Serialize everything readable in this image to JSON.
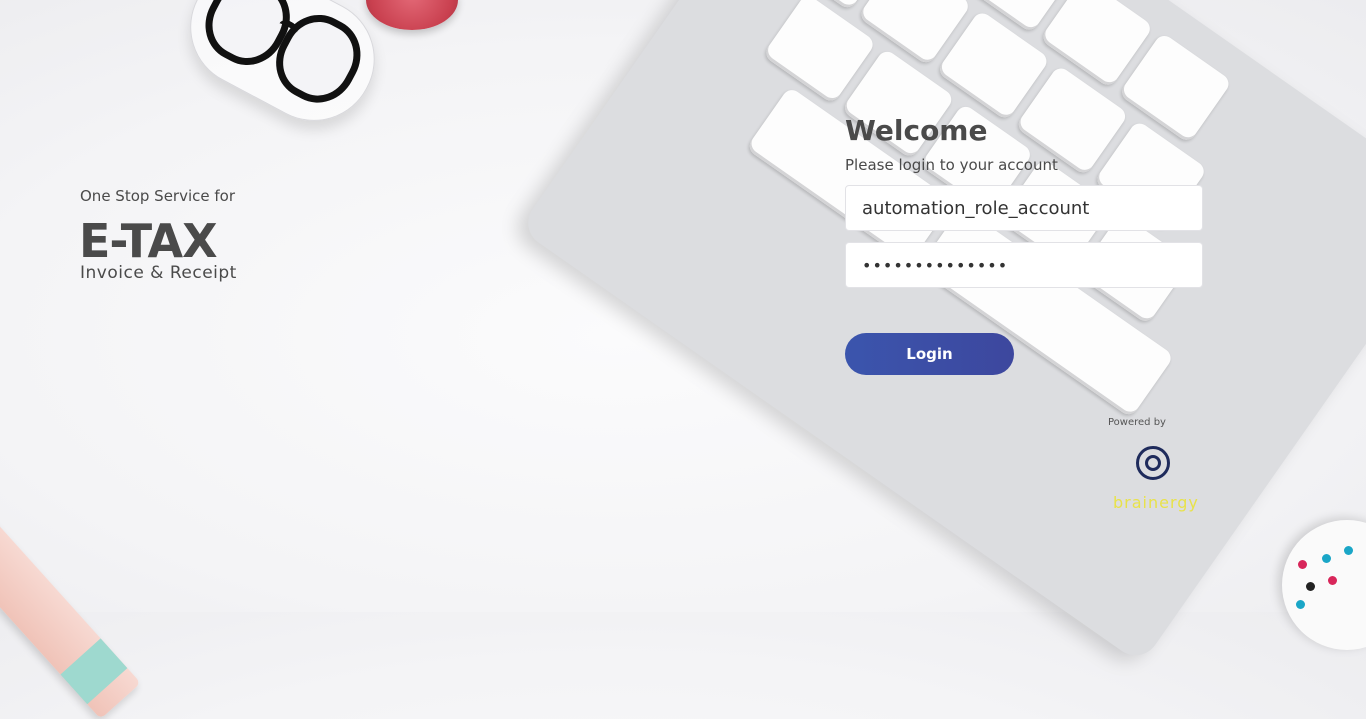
{
  "hero": {
    "tagline": "One Stop Service for",
    "brand": "E-TAX",
    "subtitle": "Invoice & Receipt"
  },
  "login": {
    "welcome": "Welcome",
    "instruction": "Please login to your account",
    "username_value": "automation_role_account",
    "password_value": "••••••••••••••",
    "button_label": "Login"
  },
  "footer": {
    "powered_by": "Powered by",
    "logo_text": "brainergy"
  },
  "colors": {
    "button": "#3b55ad",
    "logo_mark": "#1f2b5c",
    "logo_text": "#e8e24a"
  }
}
